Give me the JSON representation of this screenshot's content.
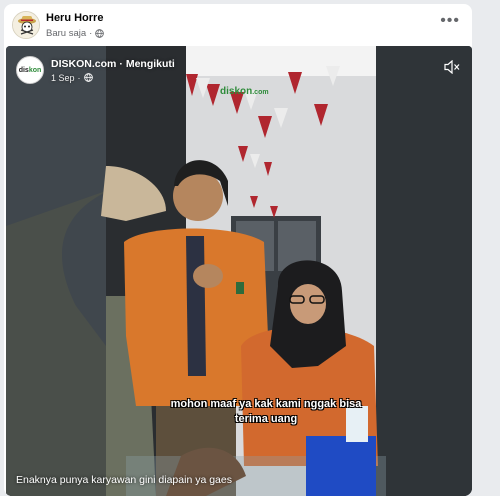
{
  "post": {
    "author": "Heru Horre",
    "time": "Baru saja",
    "more_label": "•••"
  },
  "video": {
    "page_logo_text_a": "dis",
    "page_logo_text_b": "kon",
    "page_name": "DISKON.com",
    "separator": "·",
    "follow_label": "Mengikuti",
    "date": "1 Sep",
    "sign_text_a": "dis",
    "sign_text_b": "kon",
    "sign_text_c": ".com",
    "subtitle_line1": "mohon maaf ya kak kami nggak bisa",
    "subtitle_line2": "terima uang",
    "caption": "Enaknya punya karyawan gini diapain ya gaes"
  },
  "colors": {
    "accent": "#2e8b3a",
    "bunting_red": "#b0262f",
    "shirt_orange": "#d9782c"
  },
  "icons": [
    "profile-avatar-icon",
    "globe-icon",
    "more-options-icon",
    "mute-icon"
  ]
}
